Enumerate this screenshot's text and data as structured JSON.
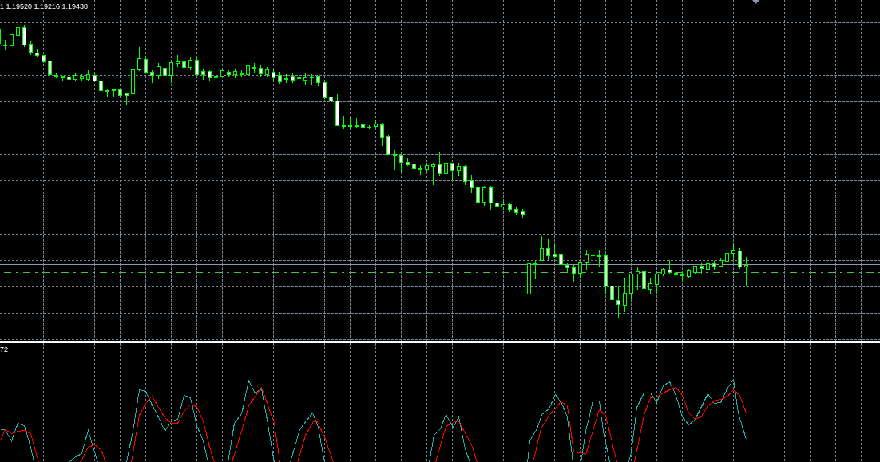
{
  "chart": {
    "header": "1 1.19520 1.19216 1.19438"
  },
  "indicator": {
    "label": "72"
  }
}
